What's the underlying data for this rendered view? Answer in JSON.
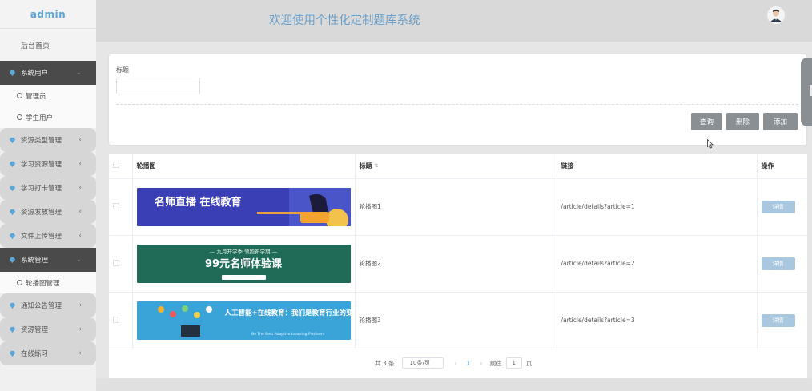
{
  "app": {
    "brand": "admin",
    "title": "欢迎使用个性化定制题库系统"
  },
  "sidebar": {
    "home": "后台首页",
    "groups": [
      {
        "label": "系统用户",
        "active": true,
        "children": [
          "管理员",
          "学生用户"
        ]
      },
      {
        "label": "资源类型管理",
        "active": false
      },
      {
        "label": "学习资源管理",
        "active": false
      },
      {
        "label": "学习打卡管理",
        "active": false
      },
      {
        "label": "资源发放管理",
        "active": false
      },
      {
        "label": "文件上传管理",
        "active": false
      },
      {
        "label": "系统管理",
        "active": true,
        "children": [
          "轮播图管理"
        ]
      },
      {
        "label": "通知公告管理",
        "active": false
      },
      {
        "label": "资源管理",
        "active": false
      },
      {
        "label": "在线练习",
        "active": false
      }
    ]
  },
  "search": {
    "label": "标题",
    "value": "",
    "buttons": {
      "query": "查询",
      "delete": "删除",
      "add": "添加"
    }
  },
  "table": {
    "columns": [
      "轮播图",
      "标题",
      "链接",
      "操作"
    ],
    "rows": [
      {
        "image_text": "名师直播 在线教育",
        "title": "轮播图1",
        "link": "/article/details?article=1",
        "action": "详情"
      },
      {
        "image_text": "99元名师体验课",
        "image_top": "— 九月开学季 领跑新学期 —",
        "title": "轮播图2",
        "link": "/article/details?article=2",
        "action": "详情"
      },
      {
        "image_text": "人工智能+在线教育：我们是教育行业的变革者",
        "image_sub": "Be The Best Adaptive Learning Platform",
        "title": "轮播图3",
        "link": "/article/details?article=3",
        "action": "详情"
      }
    ]
  },
  "pagination": {
    "total": "共 3 条",
    "page_size": "10条/页",
    "current": "1",
    "goto_label": "前往",
    "goto_value": "1",
    "page_suffix": "页"
  },
  "colors": {
    "accent": "#5aa7d8",
    "sidebar_active": "#4a4a4a",
    "button_gray": "#8a8f94",
    "detail_button": "#a9c8df",
    "banner1": "#3a3fb5",
    "banner2": "#1f6b57",
    "banner3": "#3aa4d8"
  }
}
